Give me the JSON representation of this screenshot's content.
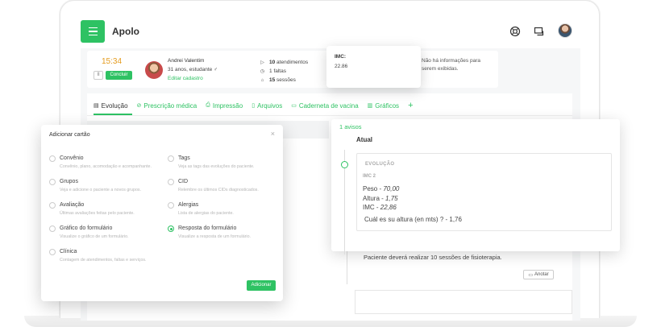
{
  "app": {
    "brand": "Apolo"
  },
  "patient": {
    "timer": "15:34",
    "conclude_label": "Concluir",
    "pause_symbol": "II",
    "name": "Andrei Valentim",
    "age": "31 anos, estudante ♂",
    "edit_label": "Editar cadastro",
    "stats": [
      {
        "icon": "play-icon",
        "bold": "10",
        "text": "atendimentos"
      },
      {
        "icon": "clock-icon",
        "bold": "1",
        "text": "faltas"
      },
      {
        "icon": "bell-icon",
        "bold": "15",
        "text": "sessões"
      }
    ],
    "no_info": "Não há informações para serem exibidas."
  },
  "imc_popup": {
    "title": "IMC:",
    "value": "22.86"
  },
  "tabs": [
    {
      "label": "Evolução",
      "icon": "document-icon",
      "active": true
    },
    {
      "label": "Prescrição médica",
      "icon": "pill-icon"
    },
    {
      "label": "Impressão",
      "icon": "printer-icon"
    },
    {
      "label": "Arquivos",
      "icon": "file-icon"
    },
    {
      "label": "Caderneta de vacina",
      "icon": "vaccine-card-icon"
    },
    {
      "label": "Gráficos",
      "icon": "chart-icon"
    }
  ],
  "add_tab_symbol": "+",
  "timeline": {
    "avisos": "1 avisos",
    "section": "Atual",
    "evo_title": "EVOLUÇÃO",
    "evo_sub": "IMC 2",
    "lines": [
      {
        "label": "Peso - ",
        "value": "70,00"
      },
      {
        "label": "Altura - ",
        "value": "1,75"
      },
      {
        "label": "IMC - ",
        "value": "22,86"
      }
    ],
    "question": "Cuál es su altura (en mts) ? - 1,76"
  },
  "note": {
    "text": "Paciente deverá realizar 10 sessões de fisioterapia.",
    "anotar": "Anotar"
  },
  "dialog": {
    "title": "Adicionar cartão",
    "close": "×",
    "options": [
      {
        "label": "Convênio",
        "desc": "Convênio, plano, acomodação e acompanhante.",
        "checked": false
      },
      {
        "label": "Tags",
        "desc": "Veja as tags das evoluções do paciente.",
        "checked": false
      },
      {
        "label": "Grupos",
        "desc": "Veja e adicione o paciente a novos grupos.",
        "checked": false
      },
      {
        "label": "CID",
        "desc": "Relembre os últimos CIDs diagnosticados.",
        "checked": false
      },
      {
        "label": "Avaliação",
        "desc": "Últimas avaliações feitas pelo paciente.",
        "checked": false
      },
      {
        "label": "Alergias",
        "desc": "Lista de alergias do paciente.",
        "checked": false
      },
      {
        "label": "Gráfico do formulário",
        "desc": "Visualize o gráfico de um formulário.",
        "checked": false
      },
      {
        "label": "Resposta do formulário",
        "desc": "Visualize a resposta de um formulário.",
        "checked": true
      },
      {
        "label": "Clínica",
        "desc": "Contagem de atendimentos, faltas e serviços.",
        "checked": false
      }
    ],
    "submit": "Adicionar"
  }
}
